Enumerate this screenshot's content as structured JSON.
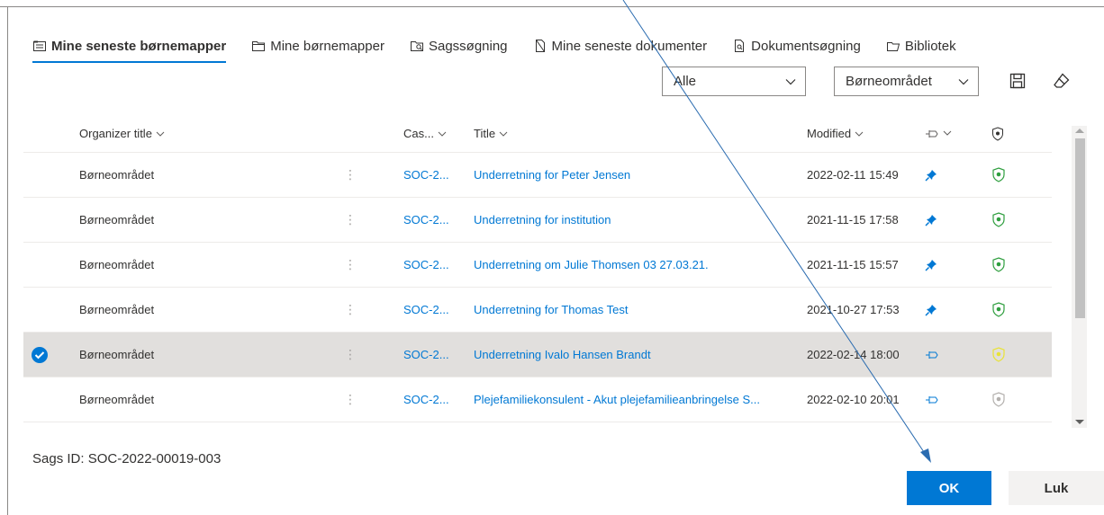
{
  "tabs": [
    {
      "label": "Mine seneste børnemapper",
      "icon": "folder-list-icon"
    },
    {
      "label": "Mine børnemapper",
      "icon": "folder-icon"
    },
    {
      "label": "Sagssøgning",
      "icon": "folder-search-icon"
    },
    {
      "label": "Mine seneste dokumenter",
      "icon": "document-icon"
    },
    {
      "label": "Dokumentsøgning",
      "icon": "document-search-icon"
    },
    {
      "label": "Bibliotek",
      "icon": "library-folder-icon"
    }
  ],
  "filters": {
    "scope": "Alle",
    "area": "Børneområdet"
  },
  "table": {
    "headers": {
      "organizer": "Organizer title",
      "case": "Cas...",
      "title": "Title",
      "modified": "Modified"
    },
    "rows": [
      {
        "organizer": "Børneområdet",
        "case": "SOC-2...",
        "title": "Underretning for Peter Jensen",
        "modified": "2022-02-11 15:49",
        "pinned": true,
        "shield": "green"
      },
      {
        "organizer": "Børneområdet",
        "case": "SOC-2...",
        "title": "Underretning for institution",
        "modified": "2021-11-15 17:58",
        "pinned": true,
        "shield": "green"
      },
      {
        "organizer": "Børneområdet",
        "case": "SOC-2...",
        "title": "Underretning om Julie Thomsen 03 27.03.21.",
        "modified": "2021-11-15 15:57",
        "pinned": true,
        "shield": "green"
      },
      {
        "organizer": "Børneområdet",
        "case": "SOC-2...",
        "title": "Underretning for Thomas Test",
        "modified": "2021-10-27 17:53",
        "pinned": true,
        "shield": "green"
      },
      {
        "organizer": "Børneområdet",
        "case": "SOC-2...",
        "title": "Underretning Ivalo Hansen Brandt",
        "modified": "2022-02-14 18:00",
        "pinned": false,
        "shield": "yellow",
        "selected": true
      },
      {
        "organizer": "Børneområdet",
        "case": "SOC-2...",
        "title": "Plejefamiliekonsulent - Akut plejefamilieanbringelse S...",
        "modified": "2022-02-10 20:01",
        "pinned": false,
        "shield": "gray"
      }
    ]
  },
  "case_id_label": "Sags ID: SOC-2022-00019-003",
  "buttons": {
    "ok": "OK",
    "close": "Luk"
  },
  "colors": {
    "accent": "#0078d4",
    "shield_green": "#2e9e3e",
    "shield_yellow": "#e8e337",
    "shield_gray": "#b3b0ad",
    "selected_row": "#e1dfdd"
  }
}
